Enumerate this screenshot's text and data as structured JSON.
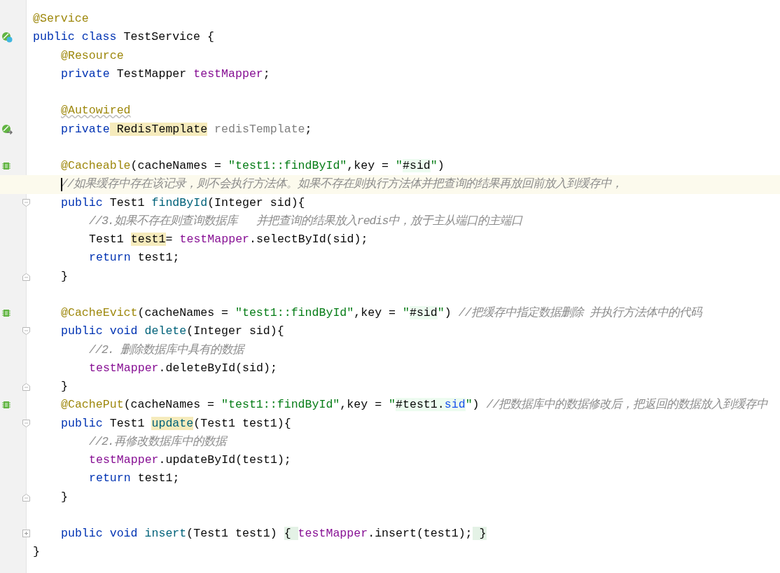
{
  "editor": {
    "lines": [
      {
        "current": false,
        "tokens": [
          {
            "text": "@Service",
            "kind": "annotation"
          }
        ]
      },
      {
        "current": false,
        "gutter": {
          "kind": "bean-class"
        },
        "tokens": [
          {
            "text": "public",
            "kind": "keyword"
          },
          {
            "text": " class",
            "kind": "keyword"
          },
          {
            "text": " TestService {",
            "kind": "plain"
          }
        ],
        "children": [
          {
            "current": false,
            "tokens": [
              {
                "text": "@Resource",
                "kind": "annotation"
              }
            ]
          },
          {
            "current": false,
            "tokens": [
              {
                "text": "private",
                "kind": "keyword"
              },
              {
                "text": " TestMapper ",
                "kind": "plain"
              },
              {
                "text": "testMapper",
                "kind": "field"
              },
              {
                "text": ";",
                "kind": "plain"
              }
            ]
          },
          {
            "current": false
          },
          {
            "current": false,
            "tokens": [
              {
                "text": "@Autowired",
                "kind": "annotation",
                "highlight": {
                  "kind": "weak-warning"
                }
              }
            ]
          },
          {
            "current": false,
            "gutter": {
              "kind": "bean-injected"
            },
            "tokens": [
              {
                "text": "private",
                "kind": "keyword"
              },
              {
                "text": " RedisTemplate",
                "kind": "plain",
                "highlight": {
                  "kind": "warning"
                }
              },
              {
                "text": " redisTemplate",
                "kind": "unused"
              },
              {
                "text": ";",
                "kind": "plain"
              }
            ]
          },
          {
            "current": false
          },
          {
            "current": false,
            "gutter": {
              "kind": "cache"
            },
            "tokens": [
              {
                "text": "@Cacheable",
                "kind": "annotation"
              },
              {
                "text": "(cacheNames = ",
                "kind": "plain"
              },
              {
                "text": "\"test1::findById\"",
                "kind": "string"
              },
              {
                "text": ",key = ",
                "kind": "plain"
              },
              {
                "text": "\"",
                "kind": "string"
              },
              {
                "text": "#sid",
                "kind": "plain",
                "highlight": {
                  "kind": "injected"
                }
              },
              {
                "text": "\"",
                "kind": "string"
              },
              {
                "text": ")",
                "kind": "plain"
              }
            ]
          },
          {
            "current": true,
            "tokens": [
              {
                "text": "//如果缓存中存在该记录，则不会执行方法体。如果不存在则执行方法体并把查询的结果再放回前放入到缓存中，",
                "kind": "comment"
              }
            ]
          },
          {
            "current": false,
            "fold": {
              "kind": "start"
            },
            "tokens": [
              {
                "text": "public",
                "kind": "keyword"
              },
              {
                "text": " Test1 ",
                "kind": "plain"
              },
              {
                "text": "findById",
                "kind": "method"
              },
              {
                "text": "(Integer sid){",
                "kind": "plain"
              }
            ],
            "children": [
              {
                "current": false,
                "tokens": [
                  {
                    "text": "//3.如果不存在则查询数据库   并把查询的结果放入redis中，放于主从端口的主端口",
                    "kind": "comment"
                  }
                ]
              },
              {
                "current": false,
                "tokens": [
                  {
                    "text": "Test1 ",
                    "kind": "plain"
                  },
                  {
                    "text": "test1",
                    "kind": "plain",
                    "highlight": {
                      "kind": "warning"
                    }
                  },
                  {
                    "text": "= ",
                    "kind": "plain"
                  },
                  {
                    "text": "testMapper",
                    "kind": "field"
                  },
                  {
                    "text": ".selectById(sid);",
                    "kind": "plain"
                  }
                ]
              },
              {
                "current": false,
                "tokens": [
                  {
                    "text": "return",
                    "kind": "keyword"
                  },
                  {
                    "text": " test1;",
                    "kind": "plain"
                  }
                ]
              }
            ]
          },
          {
            "current": false,
            "fold": {
              "kind": "end"
            },
            "tokens": [
              {
                "text": "}",
                "kind": "plain"
              }
            ]
          },
          {
            "current": false
          },
          {
            "current": false,
            "gutter": {
              "kind": "cache"
            },
            "tokens": [
              {
                "text": "@CacheEvict",
                "kind": "annotation"
              },
              {
                "text": "(cacheNames = ",
                "kind": "plain"
              },
              {
                "text": "\"test1::findById\"",
                "kind": "string"
              },
              {
                "text": ",key = ",
                "kind": "plain"
              },
              {
                "text": "\"",
                "kind": "string"
              },
              {
                "text": "#sid",
                "kind": "plain",
                "highlight": {
                  "kind": "injected"
                }
              },
              {
                "text": "\"",
                "kind": "string"
              },
              {
                "text": ") ",
                "kind": "plain"
              },
              {
                "text": "//把缓存中指定数据删除 并执行方法体中的代码",
                "kind": "comment"
              }
            ]
          },
          {
            "current": false,
            "fold": {
              "kind": "start"
            },
            "tokens": [
              {
                "text": "public",
                "kind": "keyword"
              },
              {
                "text": " void",
                "kind": "keyword"
              },
              {
                "text": " delete",
                "kind": "method"
              },
              {
                "text": "(Integer sid){",
                "kind": "plain"
              }
            ],
            "children": [
              {
                "current": false,
                "tokens": [
                  {
                    "text": "//2. 删除数据库中具有的数据",
                    "kind": "comment"
                  }
                ]
              },
              {
                "current": false,
                "tokens": [
                  {
                    "text": "testMapper",
                    "kind": "field"
                  },
                  {
                    "text": ".deleteById(sid);",
                    "kind": "plain"
                  }
                ]
              }
            ]
          },
          {
            "current": false,
            "fold": {
              "kind": "end"
            },
            "tokens": [
              {
                "text": "}",
                "kind": "plain"
              }
            ]
          },
          {
            "current": false,
            "gutter": {
              "kind": "cache"
            },
            "tokens": [
              {
                "text": "@CachePut",
                "kind": "annotation"
              },
              {
                "text": "(cacheNames = ",
                "kind": "plain"
              },
              {
                "text": "\"test1::findById\"",
                "kind": "string"
              },
              {
                "text": ",key = ",
                "kind": "plain"
              },
              {
                "text": "\"",
                "kind": "string"
              },
              {
                "text": "#test1.",
                "kind": "plain",
                "highlight": {
                  "kind": "injected"
                }
              },
              {
                "text": "sid",
                "kind": "property",
                "highlight": {
                  "kind": "injected"
                }
              },
              {
                "text": "\"",
                "kind": "string"
              },
              {
                "text": ") ",
                "kind": "plain"
              },
              {
                "text": "//把数据库中的数据修改后，把返回的数据放入到缓存中",
                "kind": "comment"
              }
            ]
          },
          {
            "current": false,
            "fold": {
              "kind": "start"
            },
            "tokens": [
              {
                "text": "public",
                "kind": "keyword"
              },
              {
                "text": " Test1 ",
                "kind": "plain"
              },
              {
                "text": "update",
                "kind": "method",
                "highlight": {
                  "kind": "warning"
                }
              },
              {
                "text": "(Test1 test1){",
                "kind": "plain"
              }
            ],
            "children": [
              {
                "current": false,
                "tokens": [
                  {
                    "text": "//2.再修改数据库中的数据",
                    "kind": "comment"
                  }
                ]
              },
              {
                "current": false,
                "tokens": [
                  {
                    "text": "testMapper",
                    "kind": "field"
                  },
                  {
                    "text": ".updateById(test1);",
                    "kind": "plain"
                  }
                ]
              },
              {
                "current": false,
                "tokens": [
                  {
                    "text": "return",
                    "kind": "keyword"
                  },
                  {
                    "text": " test1;",
                    "kind": "plain"
                  }
                ]
              }
            ]
          },
          {
            "current": false,
            "fold": {
              "kind": "end"
            },
            "tokens": [
              {
                "text": "}",
                "kind": "plain"
              }
            ]
          },
          {
            "current": false
          },
          {
            "current": false,
            "fold": {
              "kind": "collapsed"
            },
            "tokens": [
              {
                "text": "public",
                "kind": "keyword"
              },
              {
                "text": " void",
                "kind": "keyword"
              },
              {
                "text": " insert",
                "kind": "method"
              },
              {
                "text": "(Test1 test1) ",
                "kind": "plain"
              },
              {
                "text": "{ ",
                "kind": "plain",
                "highlight": {
                  "kind": "folded"
                }
              },
              {
                "text": "testMapper",
                "kind": "field"
              },
              {
                "text": ".insert(test1);",
                "kind": "plain"
              },
              {
                "text": " }",
                "kind": "plain",
                "highlight": {
                  "kind": "folded"
                }
              }
            ]
          }
        ]
      },
      {
        "current": false,
        "tokens": [
          {
            "text": "}",
            "kind": "plain"
          }
        ]
      }
    ]
  }
}
